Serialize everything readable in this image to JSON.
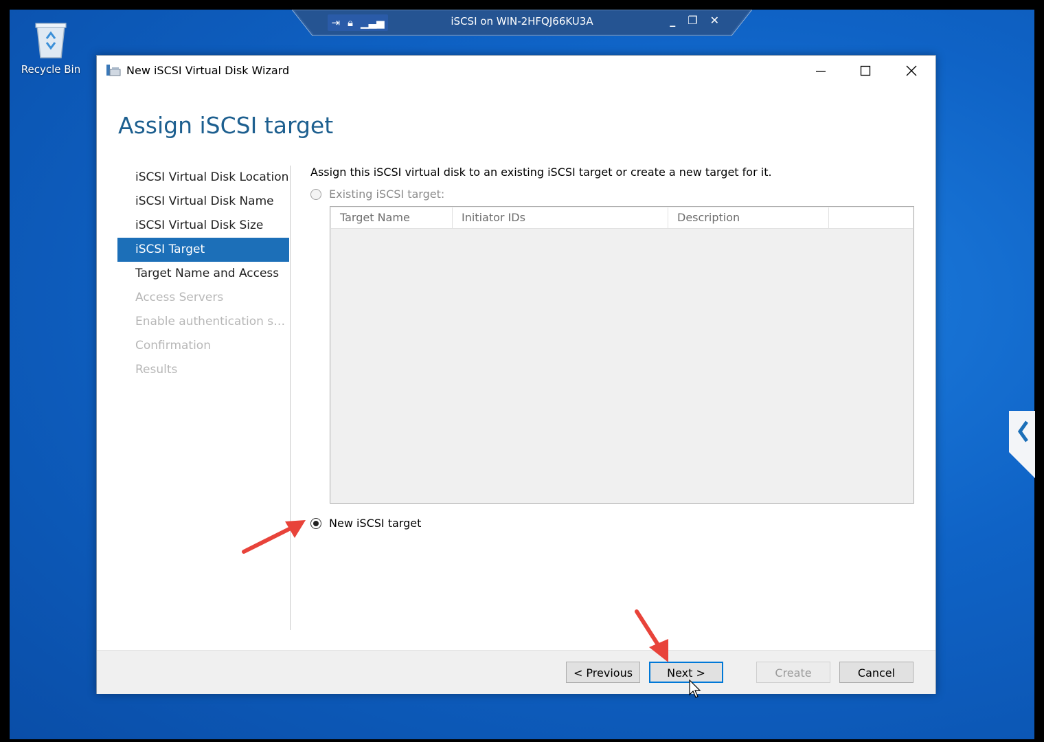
{
  "desktop": {
    "recycle_bin_label": "Recycle Bin"
  },
  "rdp_bar": {
    "title": "iSCSI on WIN-2HFQJ66KU3A",
    "icons": [
      "pin-icon",
      "lock-icon",
      "signal-icon"
    ],
    "controls": [
      "minimize-icon",
      "restore-icon",
      "close-icon"
    ]
  },
  "window": {
    "title": "New iSCSI Virtual Disk Wizard",
    "page_title": "Assign iSCSI target",
    "nav": [
      {
        "label": "iSCSI Virtual Disk Location",
        "state": "normal"
      },
      {
        "label": "iSCSI Virtual Disk Name",
        "state": "normal"
      },
      {
        "label": "iSCSI Virtual Disk Size",
        "state": "normal"
      },
      {
        "label": "iSCSI Target",
        "state": "active"
      },
      {
        "label": "Target Name and Access",
        "state": "normal"
      },
      {
        "label": "Access Servers",
        "state": "disabled"
      },
      {
        "label": "Enable authentication ser...",
        "state": "disabled"
      },
      {
        "label": "Confirmation",
        "state": "disabled"
      },
      {
        "label": "Results",
        "state": "disabled"
      }
    ],
    "description": "Assign this iSCSI virtual disk to an existing iSCSI target or create a new target for it.",
    "existing_option": {
      "label": "Existing iSCSI target:",
      "checked": false,
      "enabled": false
    },
    "table": {
      "columns": [
        "Target Name",
        "Initiator IDs",
        "Description"
      ],
      "rows": []
    },
    "new_option": {
      "label": "New iSCSI target",
      "checked": true,
      "enabled": true
    },
    "buttons": {
      "previous": "< Previous",
      "next": "Next >",
      "create": "Create",
      "cancel": "Cancel"
    }
  },
  "colors": {
    "accent": "#1c6fb8",
    "annotation_arrow": "#e8433a",
    "page_title": "#1d5f8f"
  }
}
